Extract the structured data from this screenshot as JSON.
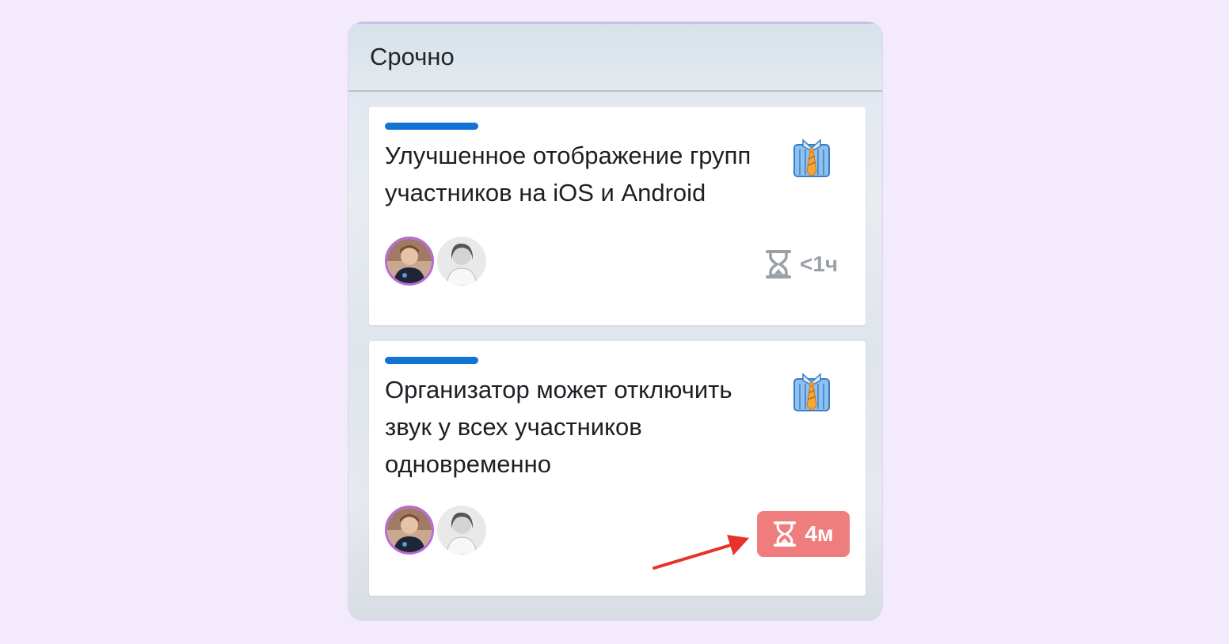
{
  "column": {
    "title": "Срочно"
  },
  "cards": [
    {
      "label_color": "#1173d4",
      "title": "Улучшенное отображение групп участников на iOS и Android",
      "type_icon": "necktie-shirt-icon",
      "due": "<1ч",
      "due_state": "neutral"
    },
    {
      "label_color": "#1173d4",
      "title": "Организатор может отключить звук у всех участников одновременно",
      "type_icon": "necktie-shirt-icon",
      "due": "4м",
      "due_state": "overdue",
      "overdue_color": "#f07d7e"
    }
  ],
  "annotation": {
    "arrow_color": "#e8322b"
  }
}
